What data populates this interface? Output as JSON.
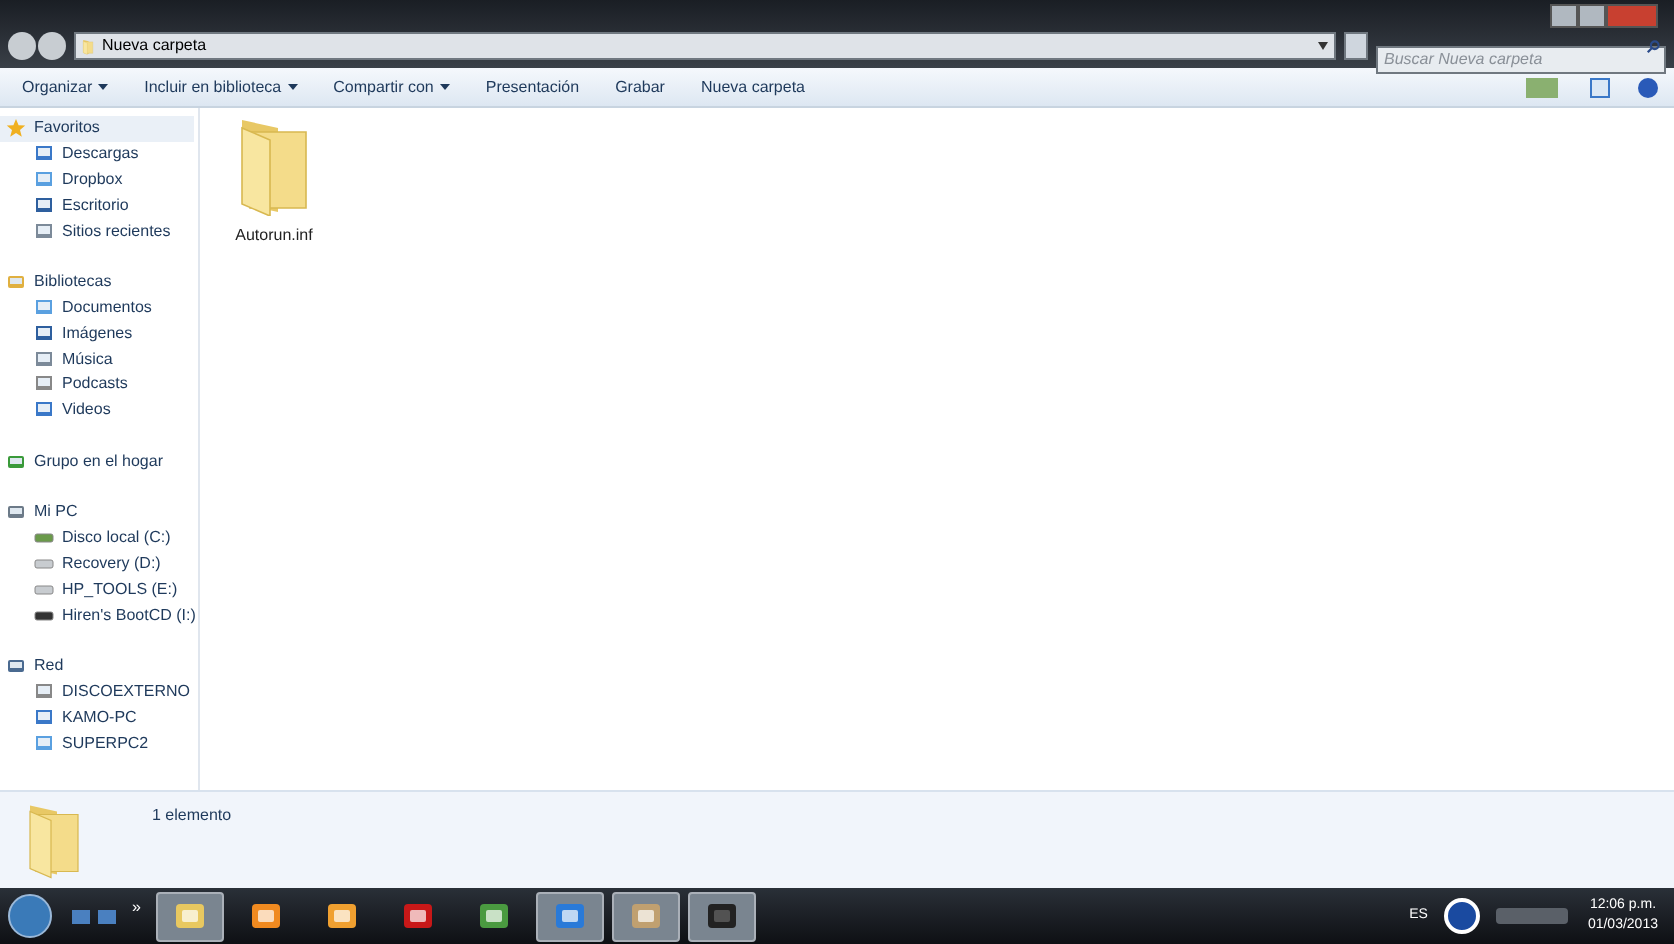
{
  "address_bar": {
    "path": [
      "Nueva carpeta"
    ]
  },
  "search": {
    "placeholder": "Buscar Nueva carpeta"
  },
  "toolbar": [
    {
      "label": "Organizar",
      "dropdown": true
    },
    {
      "label": "Incluir en biblioteca",
      "dropdown": true
    },
    {
      "label": "Compartir con",
      "dropdown": true
    },
    {
      "label": "Presentación",
      "dropdown": false
    },
    {
      "label": "Grabar",
      "dropdown": false
    },
    {
      "label": "Nueva carpeta",
      "dropdown": false
    }
  ],
  "nav_groups": [
    {
      "label": "Favoritos",
      "selected": true,
      "children": [
        {
          "label": "Descargas",
          "selected": false
        },
        {
          "label": "Dropbox",
          "selected": false
        },
        {
          "label": "Escritorio",
          "selected": false
        },
        {
          "label": "Sitios recientes",
          "selected": false
        }
      ]
    },
    {
      "label": "Bibliotecas",
      "selected": false,
      "children": [
        {
          "label": "Documentos",
          "selected": false
        },
        {
          "label": "Imágenes",
          "selected": false
        },
        {
          "label": "Música",
          "selected": false
        },
        {
          "label": "Podcasts",
          "selected": false
        },
        {
          "label": "Videos",
          "selected": false
        }
      ]
    },
    {
      "label": "Grupo en el hogar",
      "selected": false
    },
    {
      "label": "Mi PC",
      "selected": false,
      "children": [
        {
          "label": "Disco local (C:)",
          "selected": false
        },
        {
          "label": "Recovery (D:)",
          "selected": false
        },
        {
          "label": "HP_TOOLS (E:)",
          "selected": false
        },
        {
          "label": "Hiren's BootCD (I:)",
          "selected": false
        }
      ]
    },
    {
      "label": "Red",
      "selected": false,
      "children": [
        {
          "label": "DISCOEXTERNO",
          "selected": false
        },
        {
          "label": "KAMO-PC",
          "selected": false
        },
        {
          "label": "SUPERPC2",
          "selected": false
        }
      ]
    }
  ],
  "files": [
    {
      "name": "Autorun.inf",
      "selected": false
    }
  ],
  "details_pane": {
    "count": "1 elemento"
  },
  "taskbar": {
    "apps": [
      {
        "active": true
      },
      {
        "active": false
      },
      {
        "active": false
      },
      {
        "active": false
      },
      {
        "active": false
      },
      {
        "active": true
      },
      {
        "active": true
      },
      {
        "active": true
      }
    ],
    "overflow": "»",
    "language": "ES",
    "time": "12:06 p.m.",
    "date": "01/03/2013"
  }
}
